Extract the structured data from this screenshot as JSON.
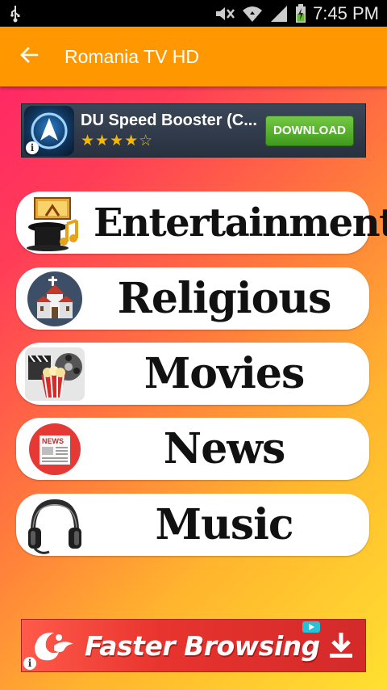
{
  "status_bar": {
    "time": "7:45 PM",
    "icons": [
      "usb-icon",
      "mute-icon",
      "wifi-icon",
      "signal-icon",
      "battery-charging-icon"
    ]
  },
  "app_bar": {
    "title": "Romania TV HD",
    "back_icon": "arrow-back-icon",
    "color": "#ff9800"
  },
  "ad_top": {
    "title": "DU Speed Booster (C...",
    "stars": "★★★★☆",
    "rating": 4.5,
    "button_label": "DOWNLOAD",
    "info_label": "i"
  },
  "categories": [
    {
      "label": "Entertainment",
      "icon": "entertainment-hat-icon"
    },
    {
      "label": "Religious",
      "icon": "church-icon"
    },
    {
      "label": "Movies",
      "icon": "movie-film-icon"
    },
    {
      "label": "News",
      "icon": "newspaper-icon"
    },
    {
      "label": "Music",
      "icon": "headphones-icon"
    }
  ],
  "ad_bottom": {
    "text": "Faster Browsing",
    "info_label": "i"
  }
}
